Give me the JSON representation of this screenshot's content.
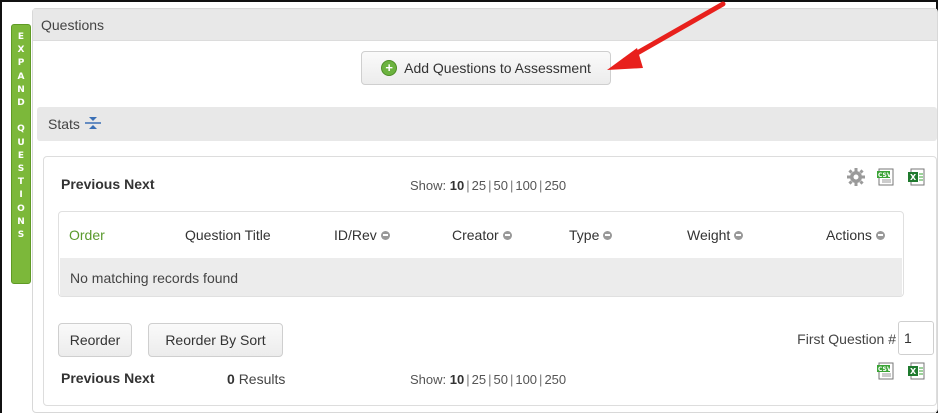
{
  "expand_tab": {
    "letters_top": [
      "E",
      "X",
      "P",
      "A",
      "N",
      "D"
    ],
    "letters_bottom": [
      "Q",
      "U",
      "E",
      "S",
      "T",
      "I",
      "O",
      "N",
      "S"
    ]
  },
  "panel": {
    "title": "Questions",
    "add_button_label": "Add Questions to Assessment",
    "stats_label": "Stats"
  },
  "pager_top": {
    "previous": "Previous",
    "next": "Next"
  },
  "pager_bottom": {
    "previous": "Previous",
    "next": "Next"
  },
  "show": {
    "label": "Show:",
    "options": [
      "10",
      "25",
      "50",
      "100",
      "250"
    ],
    "selected": "10"
  },
  "table": {
    "columns": [
      "Order",
      "Question Title",
      "ID/Rev",
      "Creator",
      "Type",
      "Weight",
      "Actions"
    ],
    "empty_message": "No matching records found"
  },
  "buttons": {
    "reorder": "Reorder",
    "reorder_by_sort": "Reorder By Sort"
  },
  "first_question": {
    "label": "First Question #",
    "value": "1"
  },
  "results": {
    "count": "0",
    "label": "Results"
  },
  "icons": {
    "settings": "gear-icon",
    "csv": "csv-export-icon",
    "excel": "excel-export-icon"
  },
  "colors": {
    "expand_tab": "#7cb83a",
    "arrow": "#e8201c",
    "order_header": "#5a9a2d"
  }
}
